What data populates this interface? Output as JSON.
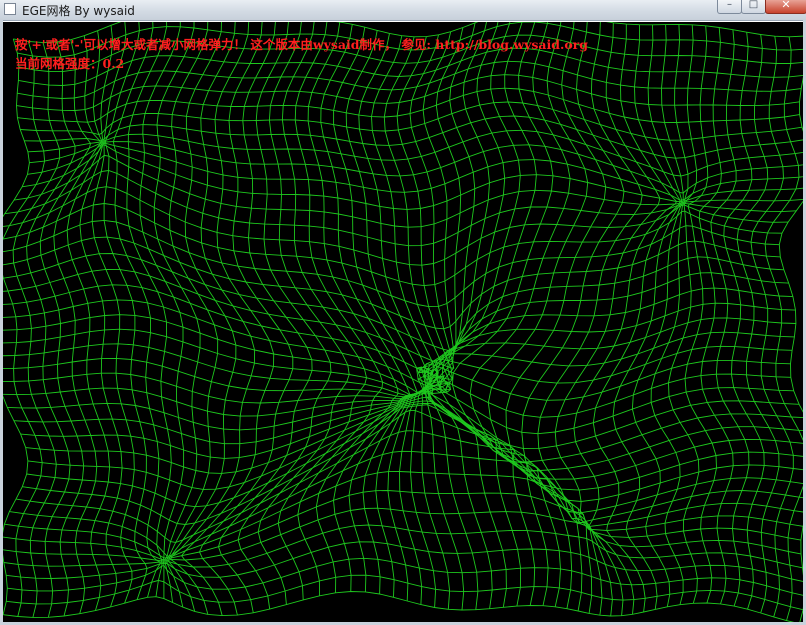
{
  "window": {
    "title": "EGE网格 By wysaid",
    "controls": {
      "minimize": "–",
      "maximize": "□",
      "close": "✕"
    }
  },
  "canvas": {
    "background": "#000000",
    "mesh_color": "#1ec81e",
    "info_color": "#ff1f1f",
    "info_line1": "按'+'或者'-'可以增大或者减小网格弹力！ 这个版本由wysaid制作， 参见: http://blog.wysaid.org",
    "info_line2": "当前网格强度：0.2"
  },
  "icons": {
    "app": "app-window-icon",
    "minimize": "minimize-icon",
    "maximize": "maximize-icon",
    "close": "close-icon"
  }
}
